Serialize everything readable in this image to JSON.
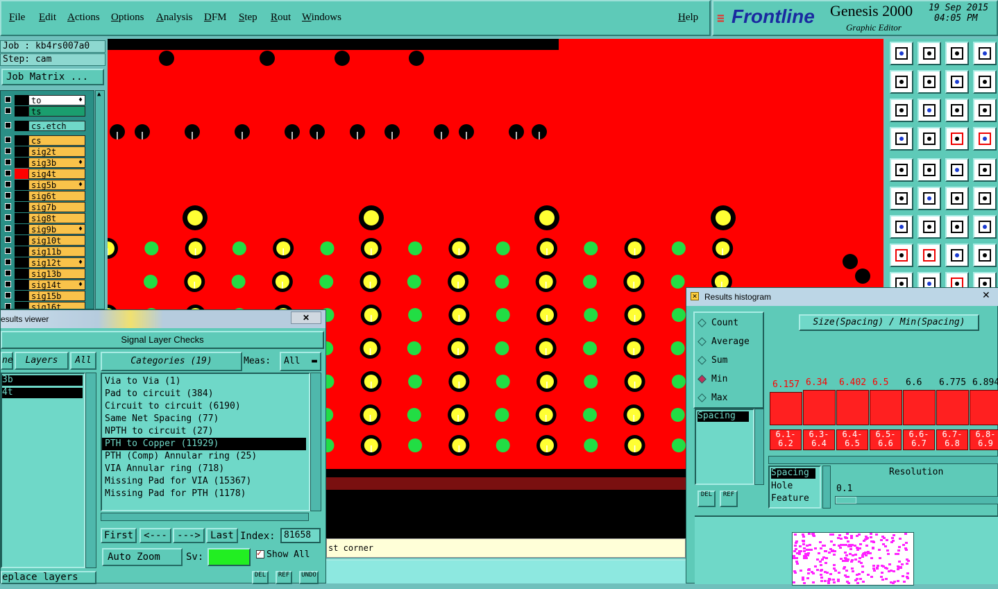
{
  "menubar": {
    "items": [
      "File",
      "Edit",
      "Actions",
      "Options",
      "Analysis",
      "DFM",
      "Step",
      "Rout",
      "Windows"
    ],
    "help": "Help"
  },
  "brand": {
    "logo_text": "Frontline",
    "product": "Genesis 2000",
    "subtitle": "Graphic Editor",
    "date": "19 Sep 2015",
    "time": "04:05 PM"
  },
  "job": {
    "job_label": "Job : kb4rs007a0",
    "step_label": "Step: cam",
    "matrix_button": "Job Matrix ..."
  },
  "layers": [
    {
      "name": "to",
      "color": "#ffffff",
      "flame": true
    },
    {
      "name": "ts",
      "color": "#1a9e6e",
      "flame": false
    },
    {
      "name": "cs.etch",
      "color": "#6fd8c8",
      "flame": false
    },
    {
      "name": "cs",
      "color": "#f9c24a",
      "flame": false
    },
    {
      "name": "sig2t",
      "color": "#f9c24a",
      "flame": false
    },
    {
      "name": "sig3b",
      "color": "#f9c24a",
      "flame": true
    },
    {
      "name": "sig4t",
      "color": "#f9c24a",
      "flame": false
    },
    {
      "name": "sig5b",
      "color": "#f9c24a",
      "flame": true
    },
    {
      "name": "sig6t",
      "color": "#f9c24a",
      "flame": false
    },
    {
      "name": "sig7b",
      "color": "#f9c24a",
      "flame": false
    },
    {
      "name": "sig8t",
      "color": "#f9c24a",
      "flame": false
    },
    {
      "name": "sig9b",
      "color": "#f9c24a",
      "flame": true
    },
    {
      "name": "sig10t",
      "color": "#f9c24a",
      "flame": false
    },
    {
      "name": "sig11b",
      "color": "#f9c24a",
      "flame": false
    },
    {
      "name": "sig12t",
      "color": "#f9c24a",
      "flame": true
    },
    {
      "name": "sig13b",
      "color": "#f9c24a",
      "flame": false
    },
    {
      "name": "sig14t",
      "color": "#f9c24a",
      "flame": true
    },
    {
      "name": "sig15b",
      "color": "#f9c24a",
      "flame": false
    },
    {
      "name": "sig16t",
      "color": "#f9c24a",
      "flame": false
    }
  ],
  "results_viewer": {
    "title": "esults viewer",
    "header": "Signal Layer Checks",
    "tab_left": "ne",
    "layers_label": "Layers",
    "all_button": "All",
    "categories_label": "Categories (19)",
    "meas_label": "Meas:",
    "meas_value": "All",
    "layer_items": [
      "3b",
      "4t"
    ],
    "categories": [
      "Via to Via (1)",
      "Pad to circuit (384)",
      "Circuit to circuit (6190)",
      "Same Net Spacing (77)",
      "NPTH to circuit (27)",
      "PTH to Copper (11929)",
      "PTH (Comp) Annular ring (25)",
      "VIA Annular ring (718)",
      "Missing Pad for VIA (15367)",
      "Missing Pad for PTH (1178)"
    ],
    "selected_category_index": 5,
    "nav": {
      "first": "First",
      "prev": "<---",
      "next": "--->",
      "last": "Last",
      "index_label": "Index:",
      "index_value": "81658"
    },
    "auto_zoom": "Auto Zoom",
    "sv_label": "Sv:",
    "show_all": "Show All",
    "replace_layers": "eplace layers",
    "small_buttons": [
      "DEL",
      "REF",
      "UNDO"
    ]
  },
  "status_text": "st corner",
  "results_histogram": {
    "title": "Results histogram",
    "modes": [
      "Count",
      "Average",
      "Sum",
      "Min",
      "Max"
    ],
    "selected_mode": "Min",
    "formula": "Size(Spacing) / Min(Spacing)",
    "list_left": [
      "Spacing"
    ],
    "list_bottom": [
      "Spacing",
      "Hole",
      "Feature"
    ],
    "resolution_label": "Resolution",
    "resolution_value": "0.1",
    "buttons": [
      "DEL",
      "REF"
    ],
    "bars": [
      {
        "value_label": "6.157",
        "range": "6.1-\n6.2",
        "height": 0.62,
        "color": "#ff0000"
      },
      {
        "value_label": "6.34",
        "range": "6.3-\n6.4",
        "height": 0.65,
        "color": "#ff0000"
      },
      {
        "value_label": "6.402",
        "range": "6.4-\n6.5",
        "height": 0.65,
        "color": "#ff0000"
      },
      {
        "value_label": "6.5",
        "range": "6.5-\n6.6",
        "height": 0.65,
        "color": "#ff0000"
      },
      {
        "value_label": "6.6",
        "range": "6.6-\n6.7",
        "height": 0.65,
        "color": "#000000"
      },
      {
        "value_label": "6.775",
        "range": "6.7-\n6.8",
        "height": 0.65,
        "color": "#000000"
      },
      {
        "value_label": "6.894",
        "range": "6.8-\n6.9",
        "height": 0.65,
        "color": "#000000"
      }
    ]
  },
  "colors": {
    "board": "#ff0000",
    "pad_yellow": "#ffff33",
    "pad_green": "#22dd44",
    "panel": "#5ecab8"
  }
}
